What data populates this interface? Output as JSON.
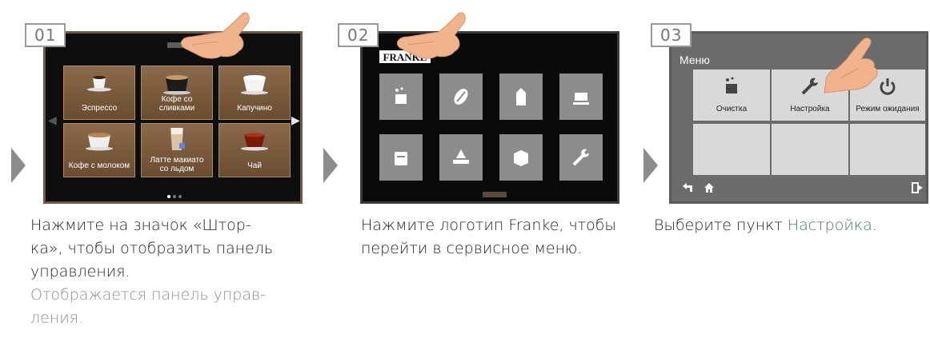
{
  "steps": [
    {
      "number": "01",
      "screen": {
        "tiles": [
          {
            "label": "Эспрессо"
          },
          {
            "label": "Кофе со сливками"
          },
          {
            "label": "Капучино"
          },
          {
            "label": "Кофе с молоком"
          },
          {
            "label": "Латте макиато со льдом"
          },
          {
            "label": "Чай"
          }
        ]
      },
      "caption": {
        "lines": [
          "Нажмите на значок «Штор-",
          "ка», чтобы отобразить панель",
          "управления."
        ],
        "result_lines": [
          "Отображается панель управ-",
          "ления."
        ]
      }
    },
    {
      "number": "02",
      "screen": {
        "logo": "FRANKE",
        "icons": [
          "cleaning-icon",
          "coffee-bean-icon",
          "milk-carton-icon",
          "cup-icon",
          "container-icon",
          "drip-tray-icon",
          "box-icon",
          "wrench-icon"
        ]
      },
      "caption": {
        "lines": [
          "Нажмите логотип Franke, чтобы",
          "перейти в сервисное меню."
        ]
      }
    },
    {
      "number": "03",
      "screen": {
        "title": "Меню",
        "tiles": [
          {
            "label": "Очистка",
            "icon": "cleaning-icon"
          },
          {
            "label": "Настройка",
            "icon": "wrench-icon"
          },
          {
            "label": "Режим ожидания",
            "icon": "power-icon"
          }
        ],
        "footer_icons": [
          "back-arrow-icon",
          "home-icon",
          "exit-icon"
        ]
      },
      "caption": {
        "prefix": "Выберите пункт ",
        "highlight": "Настройка",
        "suffix": "."
      }
    }
  ],
  "colors": {
    "arrow": "#8c8c8c",
    "highlight_text": "#53716f",
    "result_text": "#8d8d8d"
  }
}
